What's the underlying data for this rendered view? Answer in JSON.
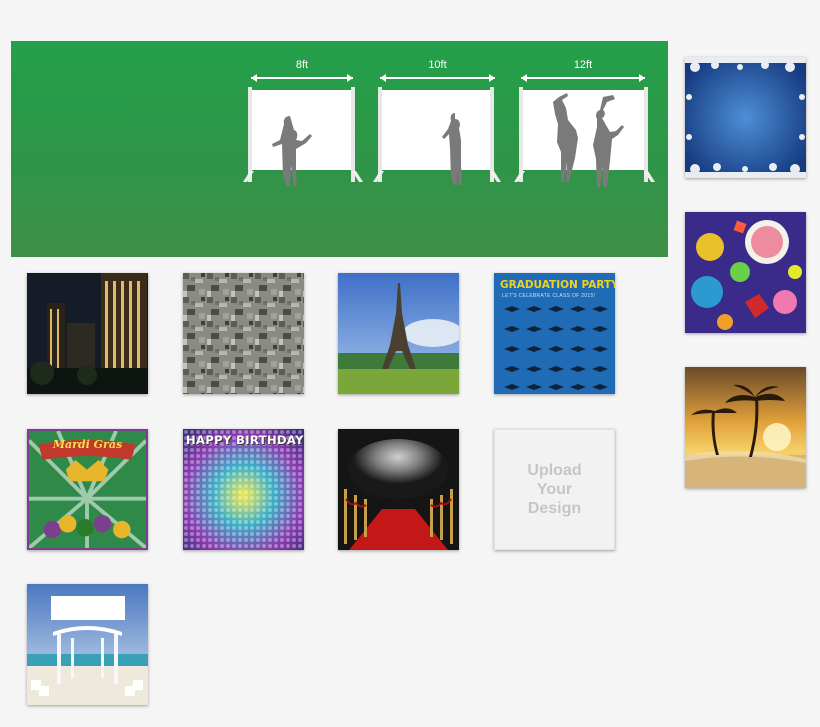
{
  "hero": {
    "sizes": [
      {
        "label": "8ft"
      },
      {
        "label": "10ft"
      },
      {
        "label": "12ft"
      }
    ]
  },
  "thumbnails": {
    "city_night": {
      "icon": "city-skyline-photo"
    },
    "digital_camo": {
      "icon": "camo-pattern"
    },
    "eiffel_tower": {
      "icon": "eiffel-tower-photo"
    },
    "graduation": {
      "title": "GRADUATION PARTY!",
      "subtitle": "LET'S CELEBRATE CLASS OF 2015!"
    },
    "mardi_gras": {
      "title": "Mardi Gras"
    },
    "birthday": {
      "title": "HAPPY BIRTHDAY"
    },
    "red_carpet": {
      "icon": "red-carpet-photo"
    },
    "upload": {
      "text": "Upload\nYour\nDesign"
    },
    "beach_wedding": {
      "icon": "beach-gazebo-photo"
    },
    "snowflake_blue": {
      "icon": "snowflake-frame"
    },
    "party_cake": {
      "icon": "party-cake-photo"
    },
    "sunset_palms": {
      "icon": "sunset-palm-photo"
    }
  },
  "colors": {
    "hero_green": "#2e9548",
    "grad_blue": "#1f6bb5",
    "grad_yellow": "#f2d21b"
  }
}
